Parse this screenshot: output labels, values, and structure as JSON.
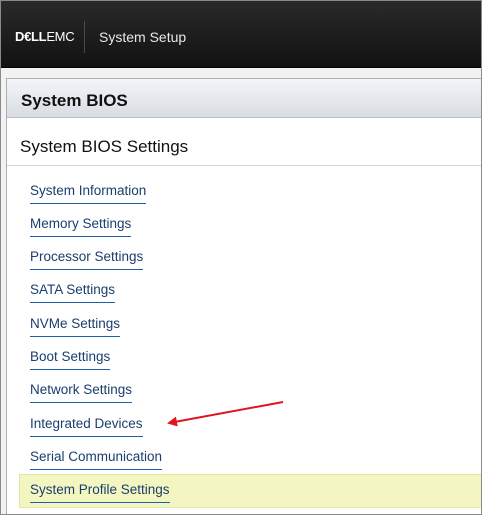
{
  "brand": {
    "logo_bold": "D€LL",
    "logo_rest": "EMC"
  },
  "header": {
    "title": "System Setup"
  },
  "section": {
    "title": "System BIOS",
    "subtitle": "System BIOS Settings"
  },
  "menu": {
    "items": [
      {
        "label": "System Information"
      },
      {
        "label": "Memory Settings"
      },
      {
        "label": "Processor Settings"
      },
      {
        "label": "SATA Settings"
      },
      {
        "label": "NVMe Settings"
      },
      {
        "label": "Boot Settings"
      },
      {
        "label": "Network Settings"
      },
      {
        "label": "Integrated Devices"
      },
      {
        "label": "Serial Communication"
      },
      {
        "label": "System Profile Settings"
      }
    ],
    "selected_index": 9
  },
  "annotation": {
    "arrow_color": "#e0141e",
    "target_item": "Integrated Devices"
  },
  "colors": {
    "header_bg": "#1c1c1c",
    "link_text": "#1a3e6e",
    "link_underline": "#1f5fa8",
    "selected_bg": "#f4f6c2"
  }
}
